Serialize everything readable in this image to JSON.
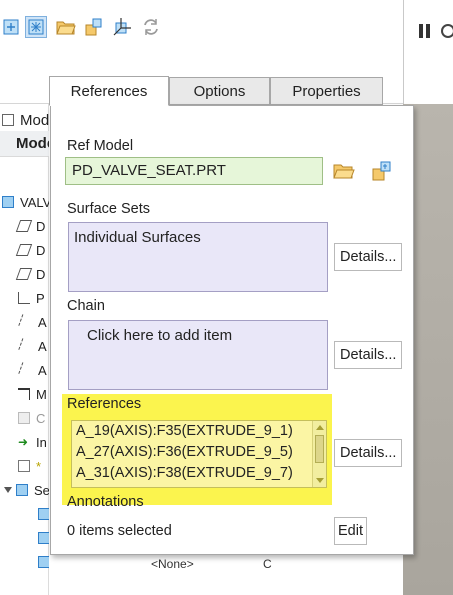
{
  "tabs": [
    {
      "label": "References",
      "active": true
    },
    {
      "label": "Options",
      "active": false
    },
    {
      "label": "Properties",
      "active": false
    }
  ],
  "tree": {
    "header": "Mode",
    "top_label": "Mod",
    "items": [
      "VALV",
      "D",
      "D",
      "D",
      "P",
      "A",
      "A",
      "A",
      "M",
      "C",
      "In",
      "*",
      "Se",
      "",
      "",
      "C"
    ]
  },
  "ref_model": {
    "label": "Ref Model",
    "value": "PD_VALVE_SEAT.PRT"
  },
  "surface_sets": {
    "label": "Surface Sets",
    "item": "Individual Surfaces",
    "details_label": "Details..."
  },
  "chain": {
    "label": "Chain",
    "placeholder": "Click here to add item",
    "details_label": "Details..."
  },
  "references": {
    "label": "References",
    "items": [
      "A_19(AXIS):F35(EXTRUDE_9_1)",
      "A_27(AXIS):F36(EXTRUDE_9_5)",
      "A_31(AXIS):F38(EXTRUDE_9_7)"
    ],
    "details_label": "Details..."
  },
  "annotations": {
    "label": "Annotations",
    "status": "0 items selected",
    "edit_label": "Edit"
  },
  "bottom_strip": {
    "text_a": "<None>",
    "text_b": "C"
  },
  "colors": {
    "highlight": "#fbf44e",
    "field_bg": "#e6f6d9",
    "collector_bg": "#e9e7f8",
    "accent_blue": "#2f7fc9"
  }
}
